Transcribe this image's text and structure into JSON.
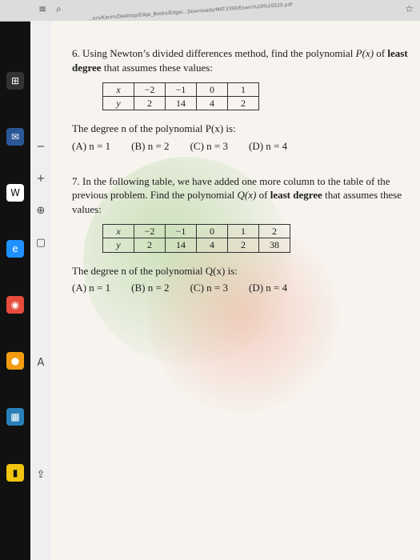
{
  "browser": {
    "url": "...ers/Karim/Desktop/Edge_Books/Edge/...Downloads/MAT3390/Exam%20%20S20.pdf",
    "zoom_icon": "zoom-in-icon",
    "minus_icon": "minus-icon",
    "plus_icon": "plus-icon",
    "page_label": "A"
  },
  "question6": {
    "title_start": "6. Using Newton’s divided differences method, find the polynomial ",
    "title_func": "P(x)",
    "title_mid": " of ",
    "title_bold": "least degree",
    "title_end": " that assumes these values:",
    "table": {
      "x_label": "x",
      "y_label": "y",
      "x_values": [
        "−2",
        "−1",
        "0",
        "1"
      ],
      "y_values": [
        "2",
        "14",
        "4",
        "2"
      ]
    },
    "prompt": "The degree n of the polynomial P(x) is:",
    "options": [
      "(A) n = 1",
      "(B) n = 2",
      "(C) n = 3",
      "(D) n = 4"
    ]
  },
  "question7": {
    "text_a": "7. In the following table, we have added one more column to the table of the previous problem. Find the polynomial ",
    "text_func": "Q(x)",
    "text_mid": " of ",
    "text_bold": "least degree",
    "text_end": " that assumes these values:",
    "table": {
      "x_label": "x",
      "y_label": "y",
      "x_values": [
        "−2",
        "−1",
        "0",
        "1",
        "2"
      ],
      "y_values": [
        "2",
        "14",
        "4",
        "2",
        "38"
      ]
    },
    "prompt": "The degree n of the polynomial Q(x) is:",
    "options": [
      "(A) n = 1",
      "(B) n = 2",
      "(C) n = 3",
      "(D) n = 4"
    ]
  }
}
